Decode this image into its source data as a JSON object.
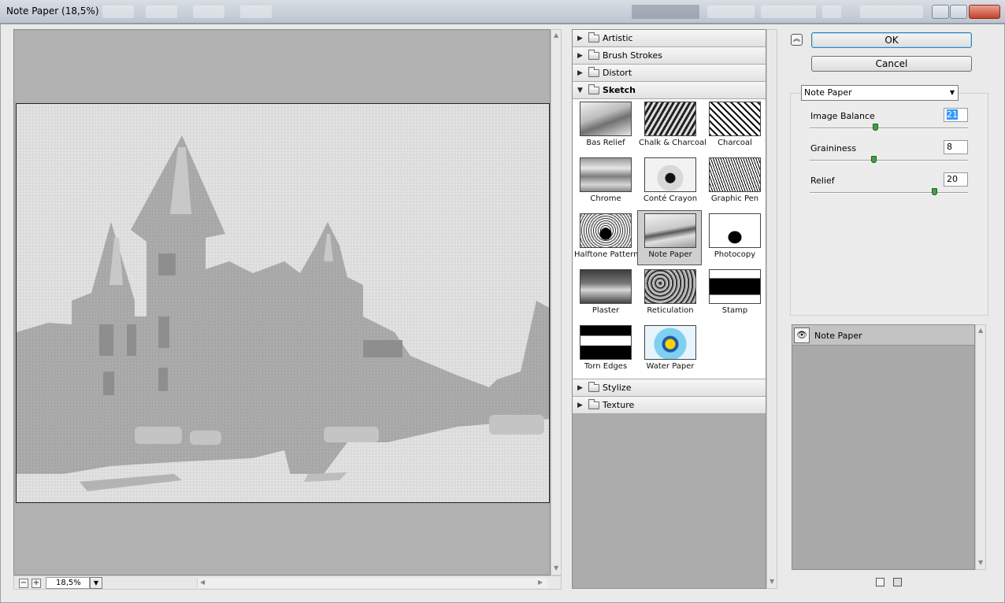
{
  "window": {
    "title": "Note Paper (18,5%)"
  },
  "preview": {
    "zoom_value": "18,5%",
    "zoom_out": "−",
    "zoom_in": "+"
  },
  "gallery": {
    "categories_top": [
      {
        "label": "Artistic"
      },
      {
        "label": "Brush Strokes"
      },
      {
        "label": "Distort"
      }
    ],
    "open_category": {
      "label": "Sketch"
    },
    "filters": [
      {
        "label": "Bas Relief"
      },
      {
        "label": "Chalk & Charcoal"
      },
      {
        "label": "Charcoal"
      },
      {
        "label": "Chrome"
      },
      {
        "label": "Conté Crayon"
      },
      {
        "label": "Graphic Pen"
      },
      {
        "label": "Halftone Pattern"
      },
      {
        "label": "Note Paper"
      },
      {
        "label": "Photocopy"
      },
      {
        "label": "Plaster"
      },
      {
        "label": "Reticulation"
      },
      {
        "label": "Stamp"
      },
      {
        "label": "Torn Edges"
      },
      {
        "label": "Water Paper"
      }
    ],
    "selected_filter": "Note Paper",
    "categories_bottom": [
      {
        "label": "Stylize"
      },
      {
        "label": "Texture"
      }
    ]
  },
  "actions": {
    "ok_label": "OK",
    "cancel_label": "Cancel"
  },
  "settings": {
    "filter_select": "Note Paper",
    "params": [
      {
        "label": "Image Balance",
        "value": "21",
        "level": 0.41
      },
      {
        "label": "Graininess",
        "value": "8",
        "level": 0.4
      },
      {
        "label": "Relief",
        "value": "20",
        "level": 0.8
      }
    ]
  },
  "layers": {
    "items": [
      {
        "label": "Note Paper"
      }
    ]
  }
}
